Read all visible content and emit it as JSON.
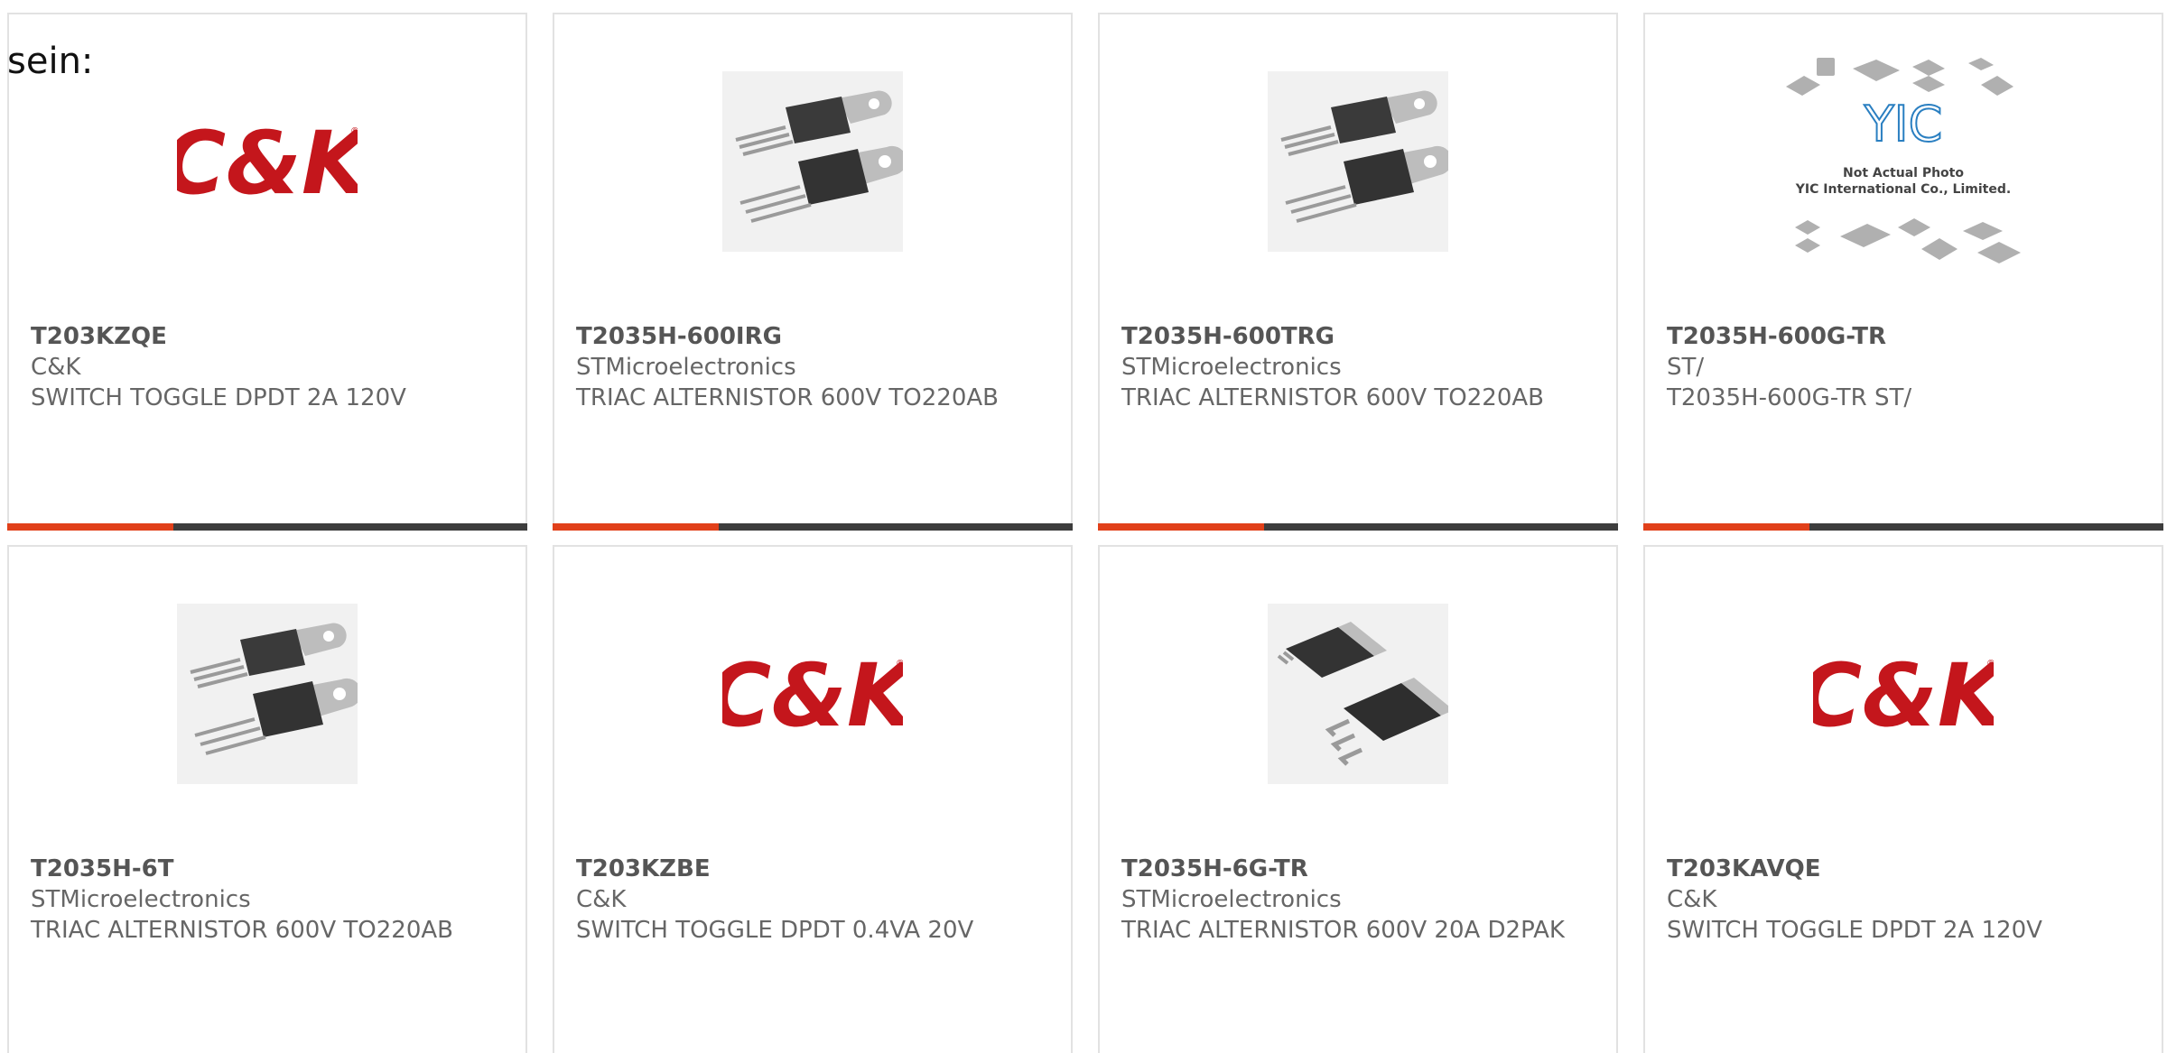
{
  "lead_text": "sein:",
  "colors": {
    "accent": "#e1401a",
    "bar": "#3d3d3d",
    "card_border": "#e2e2e2",
    "logo_red": "#c4161c",
    "text": "#666666"
  },
  "products": [
    {
      "part_number": "T203KZQE",
      "manufacturer": "C&K",
      "description": "SWITCH TOGGLE DPDT 2A 120V",
      "image": "ck-logo",
      "logo_text": "C&K"
    },
    {
      "part_number": "T2035H-600IRG",
      "manufacturer": "STMicroelectronics",
      "description": "TRIAC ALTERNISTOR 600V TO220AB",
      "image": "to220-package-icon"
    },
    {
      "part_number": "T2035H-600TRG",
      "manufacturer": "STMicroelectronics",
      "description": "TRIAC ALTERNISTOR 600V TO220AB",
      "image": "to220-package-icon"
    },
    {
      "part_number": "T2035H-600G-TR",
      "manufacturer": "ST/",
      "description": "T2035H-600G-TR ST/",
      "image": "yic-not-actual-photo",
      "logo_text": "YIC",
      "photo_note_1": "Not Actual Photo",
      "photo_note_2": "YIC International Co., Limited."
    },
    {
      "part_number": "T2035H-6T",
      "manufacturer": "STMicroelectronics",
      "description": "TRIAC ALTERNISTOR 600V TO220AB",
      "image": "to220-package-icon"
    },
    {
      "part_number": "T203KZBE",
      "manufacturer": "C&K",
      "description": "SWITCH TOGGLE DPDT 0.4VA 20V",
      "image": "ck-logo",
      "logo_text": "C&K"
    },
    {
      "part_number": "T2035H-6G-TR",
      "manufacturer": "STMicroelectronics",
      "description": "TRIAC ALTERNISTOR 600V 20A D2PAK",
      "image": "d2pak-package-icon"
    },
    {
      "part_number": "T203KAVQE",
      "manufacturer": "C&K",
      "description": "SWITCH TOGGLE DPDT 2A 120V",
      "image": "ck-logo",
      "logo_text": "C&K"
    }
  ]
}
